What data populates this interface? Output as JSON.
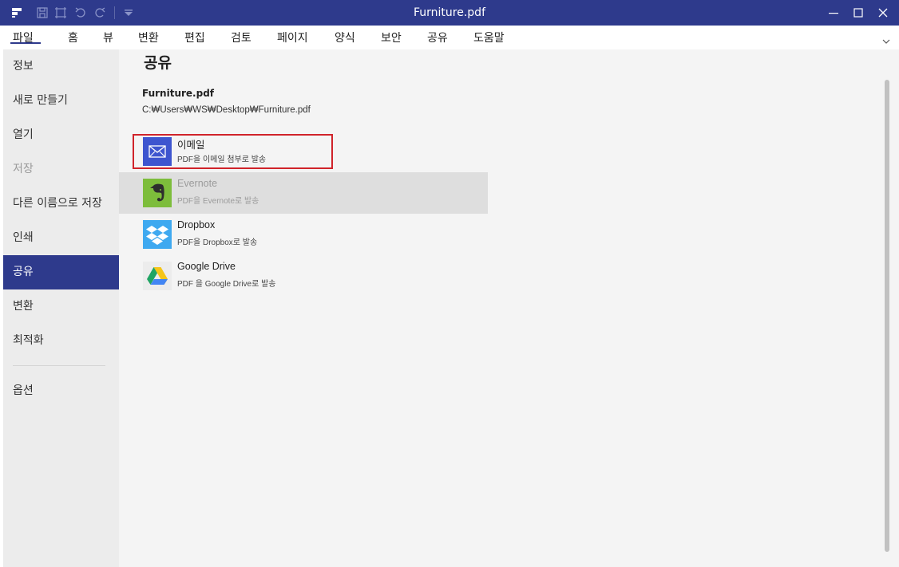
{
  "window": {
    "title": "Furniture.pdf",
    "icons": [
      "app-logo",
      "save",
      "crop",
      "undo",
      "redo",
      "quick-access-dropdown"
    ],
    "controls": [
      "minimize",
      "maximize",
      "close"
    ]
  },
  "menu": {
    "items": [
      "파일",
      "홈",
      "뷰",
      "변환",
      "편집",
      "검토",
      "페이지",
      "양식",
      "보안",
      "공유",
      "도움말"
    ],
    "active": "파일"
  },
  "sidebar": {
    "items": [
      {
        "label": "정보"
      },
      {
        "label": "새로 만들기"
      },
      {
        "label": "열기"
      },
      {
        "label": "저장",
        "state": "disabled"
      },
      {
        "label": "다른 이름으로 저장"
      },
      {
        "label": "인쇄"
      },
      {
        "label": "공유",
        "state": "active"
      },
      {
        "label": "변환"
      },
      {
        "label": "최적화"
      },
      {
        "label": "옵션"
      }
    ]
  },
  "main": {
    "title": "공유",
    "file": {
      "name": "Furniture.pdf",
      "path": "C:₩Users₩WS₩Desktop₩Furniture.pdf"
    },
    "share_options": [
      {
        "name": "이메일",
        "desc": "PDF을 이메일 첨부로 발송",
        "icon": "mail-icon",
        "color": "#3e55cf",
        "highlighted": true
      },
      {
        "name": "Evernote",
        "desc": "PDF을 Evernote로 발송",
        "icon": "evernote-icon",
        "color": "#7dbd3b",
        "state": "disabled-hover"
      },
      {
        "name": "Dropbox",
        "desc": "PDF을 Dropbox로 발송",
        "icon": "dropbox-icon",
        "color": "#3fa9f0"
      },
      {
        "name": "Google Drive",
        "desc": "PDF 을 Google Drive로 발송",
        "icon": "google-drive-icon",
        "color": "#ececec"
      }
    ]
  },
  "colors": {
    "accent": "#2e3a8c",
    "highlight_border": "#d0232a"
  }
}
